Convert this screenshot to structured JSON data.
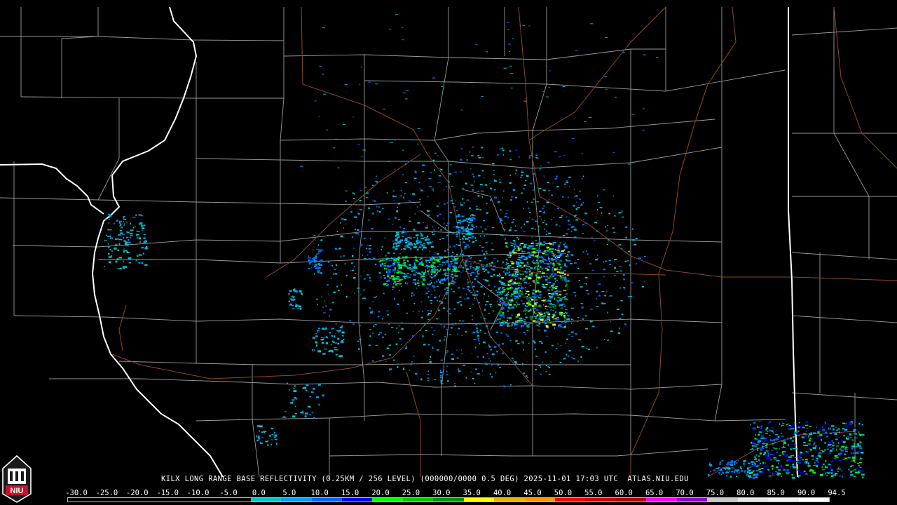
{
  "caption": "KILX LONG RANGE BASE REFLECTIVITY (0.25KM / 256 LEVEL) (000000/0000 0.5 DEG) 2025-11-01 17:03 UTC  ATLAS.NIU.EDU",
  "logo_text": "NIU",
  "scale": {
    "labels": [
      "-30.0",
      "-25.0",
      "-20.0",
      "-15.0",
      "-10.0",
      "-5.0",
      "0.0",
      "5.0",
      "10.0",
      "15.0",
      "20.0",
      "25.0",
      "30.0",
      "35.0",
      "40.0",
      "45.0",
      "50.0",
      "55.0",
      "60.0",
      "65.0",
      "70.0",
      "75.0",
      "80.0",
      "85.0",
      "90.0",
      "94.5"
    ],
    "colors": [
      "#000000",
      "#000000",
      "#000000",
      "#000000",
      "#000000",
      "#000000",
      "#00c8c8",
      "#00a0f0",
      "#0064ff",
      "#0000ff",
      "#00ff00",
      "#00c800",
      "#009600",
      "#ffff00",
      "#e6b400",
      "#ff9600",
      "#ff0000",
      "#d20000",
      "#b40000",
      "#ff00ff",
      "#9600c8",
      "#c8c8c8",
      "#e6e6e6",
      "#f0f0f0",
      "#ffffff"
    ]
  },
  "map_colors": {
    "county_lines": "#9a9a9a",
    "state_lines": "#ffffff",
    "highways": "#8b4a2b"
  }
}
